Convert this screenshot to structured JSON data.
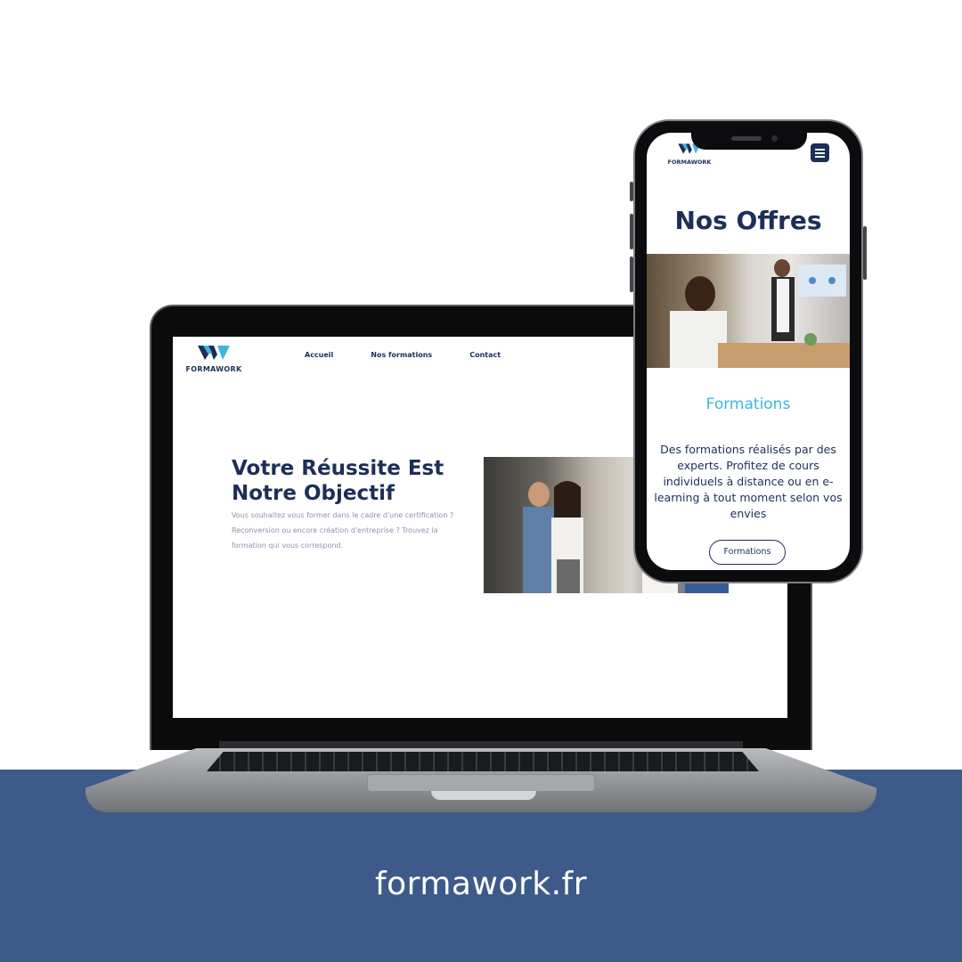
{
  "footer": {
    "url": "formawork.fr"
  },
  "colors": {
    "navy": "#1d2f57",
    "accent": "#3cb6df",
    "band": "#3d5a8a"
  },
  "laptop_site": {
    "logo_text": "FORMAWORK",
    "nav": [
      "Accueil",
      "Nos formations",
      "Contact"
    ],
    "hero_title": "Votre Réussite Est Notre Objectif",
    "hero_text": "Vous souhaitez vous former dans le cadre d'une certification ? Reconversion ou encore création d'entreprise ? Trouvez la formation qui vous correspond.",
    "hero_image_icon": "people-photo"
  },
  "phone_site": {
    "logo_text": "FORMAWORK",
    "menu_icon": "hamburger-icon",
    "title": "Nos Offres",
    "subtitle": "Formations",
    "description": "Des formations réalisés par des experts. Profitez de cours individuels à distance ou en e-learning à tout moment selon vos envies",
    "button_label": "Formations"
  }
}
